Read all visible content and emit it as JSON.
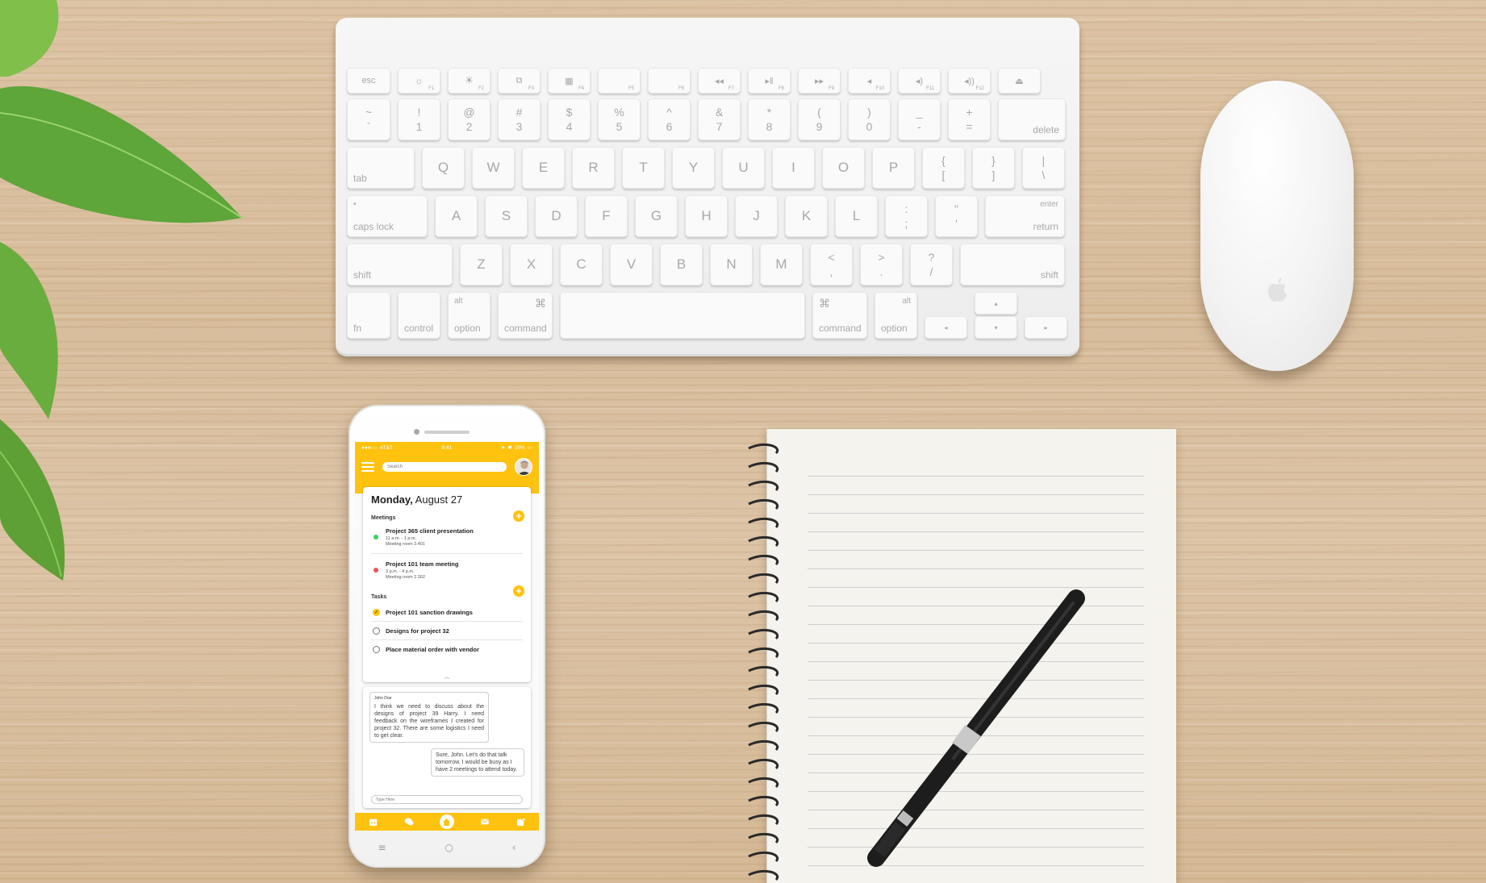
{
  "keyboard": {
    "fn_row": [
      "esc",
      "F1",
      "F2",
      "F3",
      "F4",
      "F5",
      "F6",
      "F7",
      "F8",
      "F9",
      "F10",
      "F11",
      "F12"
    ],
    "num_row": [
      {
        "top": "~",
        "bottom": "`"
      },
      {
        "top": "!",
        "bottom": "1"
      },
      {
        "top": "@",
        "bottom": "2"
      },
      {
        "top": "#",
        "bottom": "3"
      },
      {
        "top": "$",
        "bottom": "4"
      },
      {
        "top": "%",
        "bottom": "5"
      },
      {
        "top": "^",
        "bottom": "6"
      },
      {
        "top": "&",
        "bottom": "7"
      },
      {
        "top": "*",
        "bottom": "8"
      },
      {
        "top": "(",
        "bottom": "9"
      },
      {
        "top": ")",
        "bottom": "0"
      },
      {
        "top": "_",
        "bottom": "-"
      },
      {
        "top": "+",
        "bottom": "="
      }
    ],
    "delete": "delete",
    "tab": "tab",
    "qwerty": [
      "Q",
      "W",
      "E",
      "R",
      "T",
      "Y",
      "U",
      "I",
      "O",
      "P"
    ],
    "brackets": [
      {
        "top": "{",
        "bottom": "["
      },
      {
        "top": "}",
        "bottom": "]"
      },
      {
        "top": "|",
        "bottom": "\\"
      }
    ],
    "caps": "caps lock",
    "asdf": [
      "A",
      "S",
      "D",
      "F",
      "G",
      "H",
      "J",
      "K",
      "L"
    ],
    "semi": [
      {
        "top": ":",
        "bottom": ";"
      },
      {
        "top": "\"",
        "bottom": "'"
      }
    ],
    "enter": "enter",
    "return": "return",
    "shift": "shift",
    "zxcv": [
      "Z",
      "X",
      "C",
      "V",
      "B",
      "N",
      "M"
    ],
    "punct": [
      {
        "top": "<",
        "bottom": ","
      },
      {
        "top": ">",
        "bottom": "."
      },
      {
        "top": "?",
        "bottom": "/"
      }
    ],
    "fn": "fn",
    "control": "control",
    "alt": "alt",
    "option": "option",
    "command": "command",
    "command_symbol": "⌘"
  },
  "phone": {
    "status": {
      "carrier": "AT&T",
      "time": "9:41",
      "battery": "25%"
    },
    "search": {
      "placeholder": "Search"
    },
    "date": {
      "day": "Monday,",
      "rest": "August 27"
    },
    "meetings": {
      "title": "Meetings",
      "items": [
        {
          "title": "Project 365 client presentation",
          "time": "11 a.m. - 1 p.m.",
          "room": "Meeting room 3.401",
          "color": "#3ccf5a"
        },
        {
          "title": "Project 101 team meeting",
          "time": "3 p.m. - 4 p.m.",
          "room": "Meeting room 2.302",
          "color": "#f0505a"
        }
      ]
    },
    "tasks": {
      "title": "Tasks",
      "items": [
        {
          "label": "Project 101 sanction drawings",
          "done": true
        },
        {
          "label": "Designs for project 32",
          "done": false
        },
        {
          "label": "Place material order with vendor",
          "done": false
        }
      ]
    },
    "chat": {
      "incoming": {
        "from": "John Doe",
        "text": "I think we need to discuss about the designs of project 39 Harry. I need feedback on the wireframes I created for project 32. There are some logistics I need to get clear."
      },
      "outgoing": {
        "text": "Sure, John. Let's do that  talk tomorrow. I would be busy as I have 2 meetings to attend today."
      },
      "input_placeholder": "Type Here"
    },
    "accent": "#ffc20e"
  }
}
